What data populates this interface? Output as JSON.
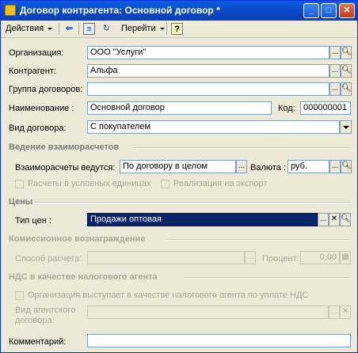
{
  "window": {
    "title": "Договор контрагента: Основной договор *",
    "buttons": {
      "minimize": "_",
      "maximize": "□",
      "close": "✕"
    }
  },
  "toolbar": {
    "actions_label": "Действия",
    "goto_label": "Перейти",
    "help_label": "?"
  },
  "form": {
    "organization": {
      "label": "Организация:",
      "value": "ООО \"Услуги\""
    },
    "counterparty": {
      "label": "Контрагент:",
      "value": "Альфа"
    },
    "contract_group": {
      "label": "Группа договоров:",
      "value": ""
    },
    "name": {
      "label": "Наименование :",
      "value": "Основной договор"
    },
    "code": {
      "label": "Код:",
      "value": "000000001"
    },
    "contract_type": {
      "label": "Вид договора:",
      "value": "С покупателем"
    }
  },
  "settlements": {
    "section_title": "Ведение взаиморасчетов",
    "conducted_label": "Взаиморасчеты ведутся:",
    "conducted_value": "По договору в целом",
    "currency_label": "Валюта :",
    "currency_value": "руб.",
    "conventional_units_label": "Расчеты в условных единицах",
    "export_label": "Реализация на экспорт"
  },
  "prices": {
    "section_title": "Цены",
    "price_type_label": "Тип цен :",
    "price_type_value": "Продажи оптовая"
  },
  "commission": {
    "section_title": "Комиссионное вознаграждение",
    "method_label": "Способ расчета:",
    "method_value": "",
    "percent_label": "Процент:",
    "percent_value": "0,00"
  },
  "vat_agent": {
    "section_title": "НДС в качестве налогового агента",
    "checkbox_label": "Организация выступает в качестве налогового агента по уплате НДС",
    "agent_contract_type_label_line1": "Вид агентского",
    "agent_contract_type_label_line2": "договора:",
    "agent_contract_type_value": ""
  },
  "comment": {
    "label": "Комментарий:",
    "value": ""
  },
  "glyphs": {
    "ellipsis": "...",
    "clear": "✕"
  }
}
